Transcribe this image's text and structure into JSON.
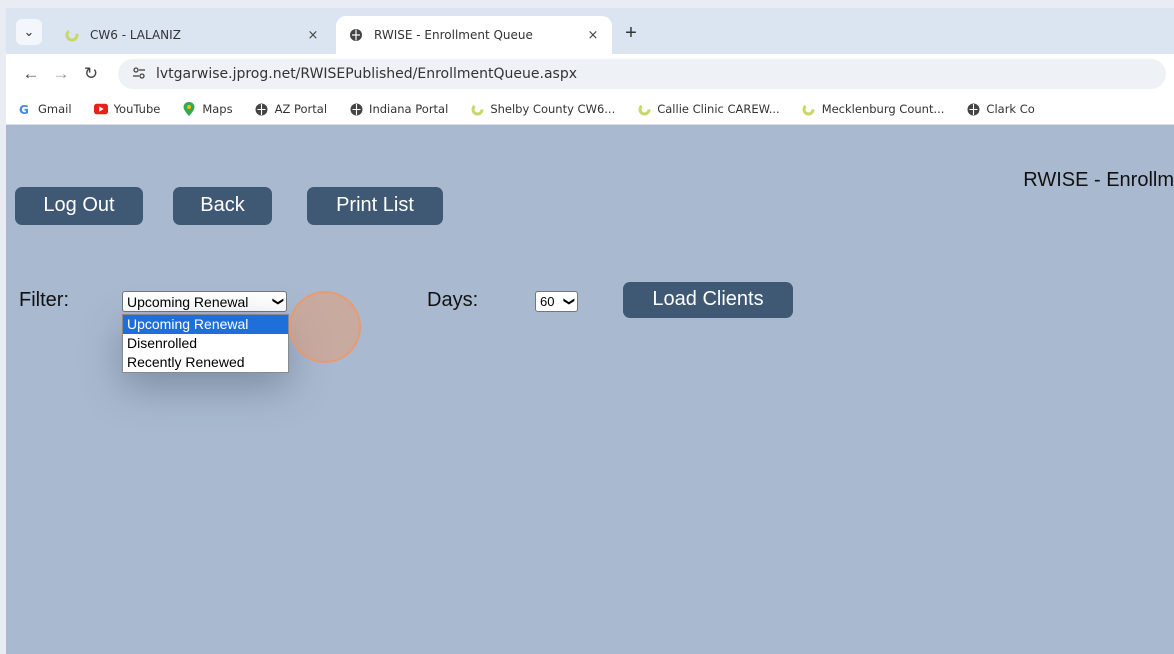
{
  "browser": {
    "tabs": [
      {
        "title": "CW6 - LALANIZ",
        "active": false
      },
      {
        "title": "RWISE - Enrollment Queue",
        "active": true
      }
    ],
    "new_tab_symbol": "+",
    "close_symbol": "×",
    "url": "lvtgarwise.jprog.net/RWISEPublished/EnrollmentQueue.aspx",
    "bookmarks": [
      {
        "label": "Gmail",
        "icon": "google-icon"
      },
      {
        "label": "YouTube",
        "icon": "youtube-icon"
      },
      {
        "label": "Maps",
        "icon": "maps-pin-icon"
      },
      {
        "label": "AZ Portal",
        "icon": "globe-icon"
      },
      {
        "label": "Indiana Portal",
        "icon": "globe-icon"
      },
      {
        "label": "Shelby County CW6...",
        "icon": "spinner-icon"
      },
      {
        "label": "Callie Clinic CAREW...",
        "icon": "spinner-icon"
      },
      {
        "label": "Mecklenburg Count...",
        "icon": "spinner-icon"
      },
      {
        "label": "Clark Co",
        "icon": "globe-icon"
      }
    ]
  },
  "page": {
    "title": "RWISE - Enrollm",
    "buttons": {
      "logout": "Log Out",
      "back": "Back",
      "print": "Print List",
      "load_clients": "Load Clients"
    },
    "filter": {
      "label": "Filter:",
      "selected": "Upcoming Renewal",
      "options": [
        "Upcoming Renewal",
        "Disenrolled",
        "Recently Renewed"
      ]
    },
    "days": {
      "label": "Days:",
      "selected": "60"
    }
  },
  "colors": {
    "page_bg": "#a9bad0",
    "button_bg": "#3f5873",
    "selected_option": "#1e6fd9",
    "click_marker": "#f0966a"
  }
}
